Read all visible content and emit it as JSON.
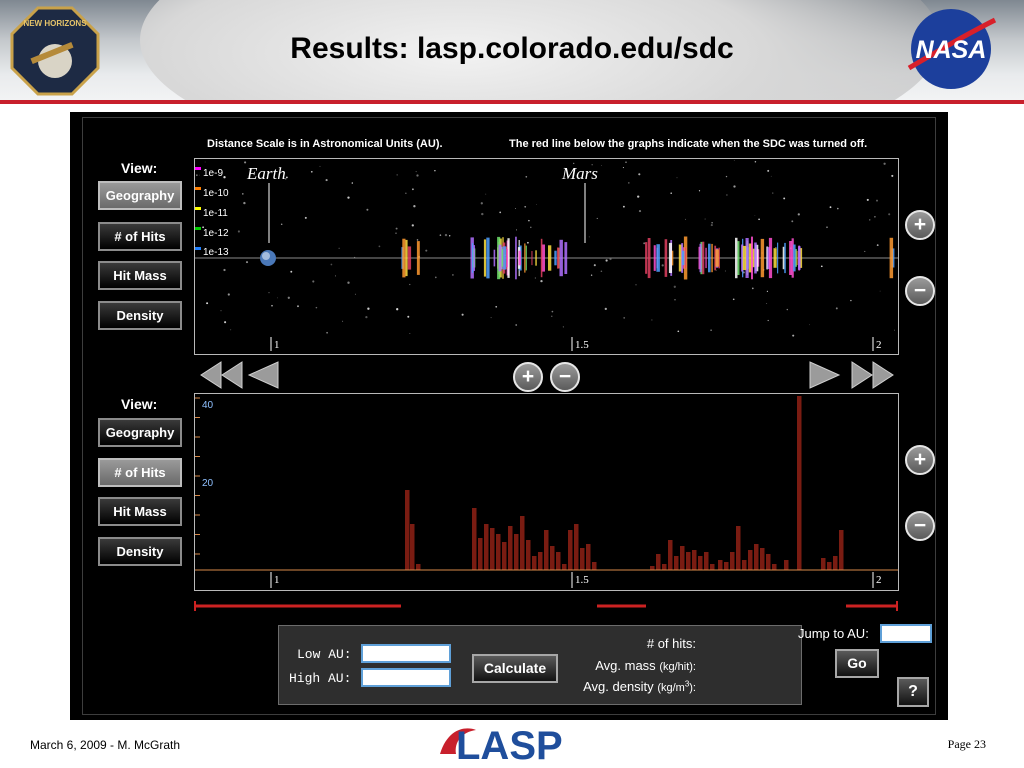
{
  "slide": {
    "title": "Results: lasp.colorado.edu/sdc",
    "footer_left": "March 6, 2009 - M. McGrath",
    "footer_right": "Page 23",
    "logos": {
      "left": "NEW HORIZONS",
      "right": "NASA",
      "bottom": "LASP"
    }
  },
  "app": {
    "note_left": "Distance Scale is in Astronomical Units (AU).",
    "note_right": "The red line below the graphs indicate when the SDC was turned off.",
    "view_label": "View:",
    "view_buttons": [
      "Geography",
      "# of Hits",
      "Hit Mass",
      "Density"
    ],
    "top_graph": {
      "active_view": "Geography",
      "legend_scale": [
        "1e-9",
        "1e-10",
        "1e-11",
        "1e-12",
        "1e-13"
      ],
      "planet_labels": [
        "Earth",
        "Mars"
      ],
      "x_ticks": [
        "1",
        "1.5",
        "2"
      ]
    },
    "bottom_graph": {
      "active_view": "# of Hits",
      "y_labels": [
        "40",
        "20"
      ],
      "x_ticks": [
        "1",
        "1.5",
        "2"
      ]
    },
    "zoom_in_label": "+",
    "zoom_out_label": "−",
    "form": {
      "low_label": "Low AU:",
      "high_label": "High AU:",
      "low_value": "",
      "high_value": "",
      "calculate_label": "Calculate",
      "hits_label": "# of hits:",
      "mass_label": "Avg. mass",
      "mass_unit": "(kg/hit):",
      "density_label": "Avg. density",
      "density_unit_base": "(kg/m",
      "density_unit_exp": "3",
      "density_unit_tail": "):"
    },
    "jump": {
      "label": "Jump to AU:",
      "value": "",
      "go_label": "Go"
    },
    "help_label": "?"
  },
  "colors": {
    "accent_red": "#c8202c",
    "hit_bar": "#7a1c12",
    "input_border": "#5fa0d8"
  },
  "icons": [
    "new-horizons-logo",
    "nasa-logo",
    "lasp-logo",
    "rewind-icon",
    "step-back-icon",
    "step-forward-icon",
    "fast-forward-icon",
    "zoom-in-icon",
    "zoom-out-icon",
    "help-icon"
  ]
}
